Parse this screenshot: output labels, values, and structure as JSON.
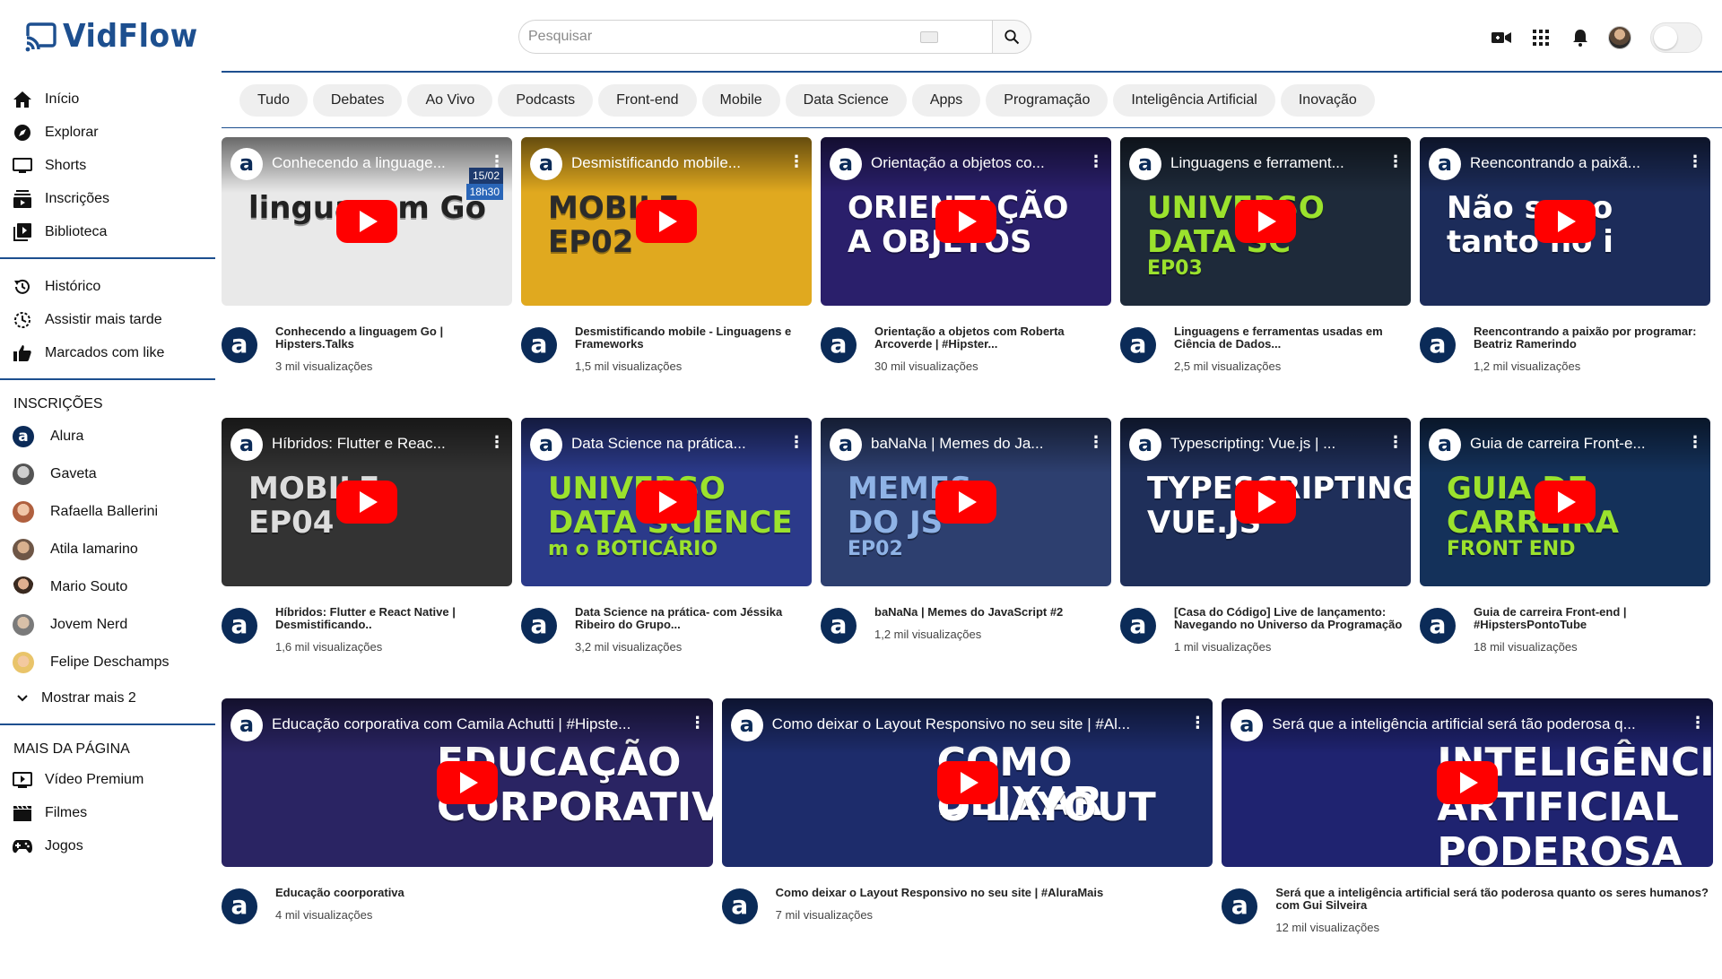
{
  "app": {
    "name": "VidFlow",
    "brand_color": "#1d4f8f"
  },
  "search": {
    "placeholder": "Pesquisar"
  },
  "header_icons": [
    "video-camera-icon",
    "apps-grid-icon",
    "bell-icon",
    "user-avatar",
    "theme-toggle"
  ],
  "sidebar": {
    "main": [
      {
        "label": "Início",
        "icon": "home-icon"
      },
      {
        "label": "Explorar",
        "icon": "compass-icon"
      },
      {
        "label": "Shorts",
        "icon": "shorts-icon"
      },
      {
        "label": "Inscrições",
        "icon": "subscriptions-icon"
      },
      {
        "label": "Biblioteca",
        "icon": "library-icon"
      }
    ],
    "secondary": [
      {
        "label": "Histórico",
        "icon": "history-icon"
      },
      {
        "label": "Assistir mais tarde",
        "icon": "watch-later-icon"
      },
      {
        "label": "Marcados com like",
        "icon": "thumbs-up-icon"
      }
    ],
    "subscriptions_heading": "INSCRIÇÕES",
    "subscriptions": [
      {
        "label": "Alura",
        "color": "#0b2b58"
      },
      {
        "label": "Gaveta",
        "color": "#6b6b6b"
      },
      {
        "label": "Rafaella Ballerini",
        "color": "#c48a6a"
      },
      {
        "label": "Atila Iamarino",
        "color": "#8a6a52"
      },
      {
        "label": "Mario Souto",
        "color": "#4a3426"
      },
      {
        "label": "Jovem Nerd",
        "color": "#7a7a7a"
      },
      {
        "label": "Felipe Deschamps",
        "color": "#e9c46a"
      }
    ],
    "show_more": "Mostrar mais 2",
    "more_heading": "MAIS DA PÁGINA",
    "more": [
      {
        "label": "Vídeo Premium",
        "icon": "premium-video-icon"
      },
      {
        "label": "Filmes",
        "icon": "clapperboard-icon"
      },
      {
        "label": "Jogos",
        "icon": "gamepad-icon"
      }
    ]
  },
  "chips": [
    "Tudo",
    "Debates",
    "Ao Vivo",
    "Podcasts",
    "Front-end",
    "Mobile",
    "Data Science",
    "Apps",
    "Programação",
    "Inteligência Artificial",
    "Inovação"
  ],
  "videos_row1": [
    {
      "thumb_title": "Conhecendo a linguage...",
      "title": "Conhecendo a linguagem Go | Hipsters.Talks",
      "views": "3 mil visualizações",
      "bg": "#e9e9e9",
      "overlay": "linguagem Go",
      "overlay_color": "#222",
      "date": "15/02",
      "time": "18h30"
    },
    {
      "thumb_title": "Desmistificando mobile...",
      "title": "Desmistificando mobile - Linguagens e Frameworks",
      "views": "1,5 mil visualizações",
      "bg": "#e0a91f",
      "overlay": "MOBILE",
      "overlay2": "EP02",
      "overlay_color": "#2b2b2b"
    },
    {
      "thumb_title": "Orientação a objetos co...",
      "title": "Orientação a objetos com Roberta Arcoverde | #Hipster...",
      "views": "30 mil visualizações",
      "bg": "#2a1f6b",
      "overlay": "ORIENTAÇÃO",
      "overlay2": "A OBJETOS",
      "overlay_color": "#ffffff"
    },
    {
      "thumb_title": "Linguagens e ferrament...",
      "title": "Linguagens e ferramentas usadas em Ciência de Dados...",
      "views": "2,5 mil visualizações",
      "bg": "#1e2a3a",
      "overlay": "UNIVERSO",
      "overlay2": "DATA SC",
      "overlay3": "EP03",
      "overlay_color": "#9be22d"
    },
    {
      "thumb_title": "Reencontrando a paixã...",
      "title": "Reencontrando a paixão por programar: Beatriz Ramerindo",
      "views": "1,2 mil visualizações",
      "bg": "#1c2c5a",
      "overlay": "Não se co",
      "overlay2": "tanto no i",
      "overlay_color": "#ffffff"
    }
  ],
  "videos_row2": [
    {
      "thumb_title": "Híbridos: Flutter e Reac...",
      "title": "Híbridos: Flutter e React Native | Desmistificando..",
      "views": "1,6 mil visualizações",
      "bg": "#333333",
      "overlay": "MOBILE",
      "overlay2": "EP04",
      "overlay_color": "#dddddd"
    },
    {
      "thumb_title": "Data Science na prática...",
      "title": "Data Science na prática- com Jéssika Ribeiro do Grupo...",
      "views": "3,2 mil visualizações",
      "bg": "#2b3a8a",
      "overlay": "UNIVERSO",
      "overlay2": "DATA SCIENCE",
      "overlay3": "m o BOTICÁRIO",
      "overlay_color": "#9be22d"
    },
    {
      "thumb_title": "baNaNa | Memes do Ja...",
      "title": "baNaNa | Memes do JavaScript #2",
      "views": "1,2 mil visualizações",
      "bg": "#2d3f6f",
      "overlay": "MEMES",
      "overlay2": "DO JS",
      "overlay3": "EP02",
      "overlay_color": "#8fb3e6"
    },
    {
      "thumb_title": "Typescripting: Vue.js | ...",
      "title": "[Casa do Código] Live de lançamento: Navegando no Universo da Programação",
      "views": "1 mil visualizações",
      "bg": "#1f2f5a",
      "overlay": "TYPESCRIPTING:",
      "overlay2": "VUE.JS",
      "overlay_color": "#ffffff"
    },
    {
      "thumb_title": "Guia de carreira Front-e...",
      "title": "Guia de carreira Front-end | #HipstersPontoTube",
      "views": "18 mil visualizações",
      "bg": "#14315a",
      "overlay": "GUIA DE",
      "overlay2": "CARREIRA",
      "overlay3": "FRONT END",
      "overlay_color": "#9be22d"
    }
  ],
  "videos_row3": [
    {
      "thumb_title": "Educação corporativa com Camila Achutti | #Hipste...",
      "title": "Educação coorporativa",
      "views": "4 mil visualizações",
      "bg": "#2a2463",
      "overlay": "EDUCAÇÃO",
      "overlay2": "CORPORATIVA",
      "overlay_color": "#ffffff"
    },
    {
      "thumb_title": "Como deixar o Layout Responsivo no seu site | #Al...",
      "title": "Como deixar o Layout Responsivo no seu site | #AluraMais",
      "views": "7 mil visualizações",
      "bg": "#1d2c6b",
      "overlay": "COMO DEIXAR",
      "overlay2": "O LAYOUT",
      "overlay_color": "#ffffff"
    },
    {
      "thumb_title": "Será que a inteligência artificial será tão poderosa q...",
      "title": "Será que a inteligência artificial será tão poderosa quanto os seres humanos? com Gui Silveira",
      "views": "12 mil visualizações",
      "bg": "#1f2370",
      "overlay": "INTELIGÊNCIA",
      "overlay2": "ARTIFICIAL",
      "overlay3": "PODEROSA",
      "overlay_color": "#ffffff"
    }
  ]
}
